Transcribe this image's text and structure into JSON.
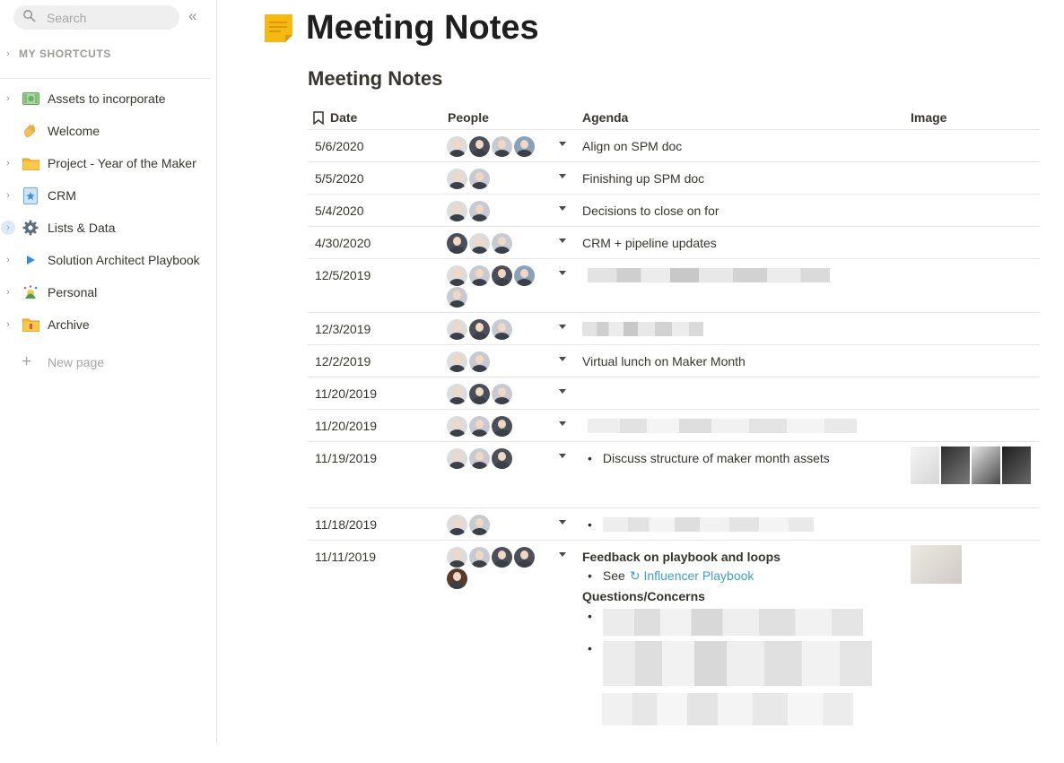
{
  "sidebar": {
    "search_placeholder": "Search",
    "collapse_glyph": "«",
    "shortcuts_label": "MY SHORTCUTS",
    "items": [
      {
        "label": "Assets to incorporate",
        "icon": "money-icon"
      },
      {
        "label": "Welcome",
        "icon": "waving-hand-icon"
      },
      {
        "label": "Project - Year of the Maker",
        "icon": "folder-icon"
      },
      {
        "label": "CRM",
        "icon": "star-card-icon"
      },
      {
        "label": "Lists & Data",
        "icon": "gear-icon"
      },
      {
        "label": "Solution Architect Playbook",
        "icon": "play-icon"
      },
      {
        "label": "Personal",
        "icon": "party-icon"
      },
      {
        "label": "Archive",
        "icon": "archive-folder-icon"
      }
    ],
    "new_page_label": "New page"
  },
  "page": {
    "title": "Meeting Notes",
    "icon": "sticky-note-icon",
    "accent_color": "#f5b90f"
  },
  "database": {
    "title": "Meeting Notes",
    "columns": [
      "Date",
      "People",
      "Agenda",
      "Image"
    ],
    "rows": [
      {
        "date": "5/6/2020",
        "people": 4,
        "agenda": "Align on SPM doc"
      },
      {
        "date": "5/5/2020",
        "people": 2,
        "agenda": "Finishing up SPM doc"
      },
      {
        "date": "5/4/2020",
        "people": 2,
        "agenda": "Decisions to close on for"
      },
      {
        "date": "4/30/2020",
        "people": 3,
        "agenda": "CRM + pipeline updates"
      },
      {
        "date": "12/5/2019",
        "people": 5,
        "agenda": ""
      },
      {
        "date": "12/3/2019",
        "people": 3,
        "agenda": ""
      },
      {
        "date": "12/2/2019",
        "people": 2,
        "agenda": "Virtual lunch on Maker Month"
      },
      {
        "date": "11/20/2019",
        "people": 3,
        "agenda": ""
      },
      {
        "date": "11/20/2019",
        "people": 3,
        "agenda": ""
      },
      {
        "date": "11/19/2019",
        "people": 3,
        "agenda": "Discuss structure of maker month assets"
      },
      {
        "date": "11/18/2019",
        "people": 2,
        "agenda": ""
      },
      {
        "date": "11/11/2019",
        "people": 5,
        "agenda": "Feedback on playbook and loops"
      }
    ],
    "last_row": {
      "see_label": "See",
      "link_text": "Influencer Playbook",
      "questions_heading": "Questions/Concerns"
    }
  }
}
